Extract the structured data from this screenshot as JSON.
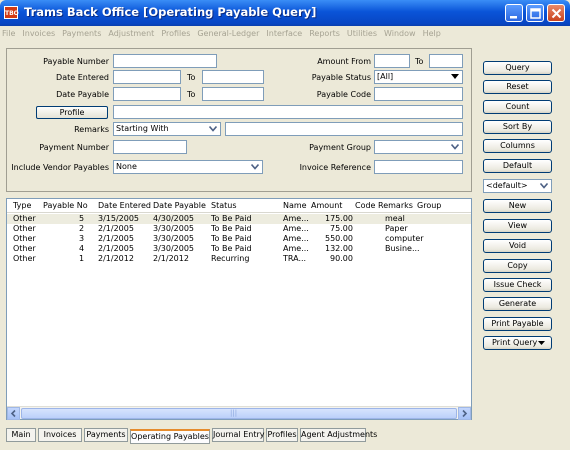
{
  "window": {
    "app_icon_text": "TBO",
    "title": "Trams Back Office [Operating Payable Query]"
  },
  "menu": [
    "File",
    "Invoices",
    "Payments",
    "Adjustment",
    "Profiles",
    "General-Ledger",
    "Interface",
    "Reports",
    "Utilities",
    "Window",
    "Help"
  ],
  "criteria": {
    "payable_number_label": "Payable Number",
    "date_entered_label": "Date Entered",
    "date_payable_label": "Date Payable",
    "to_label_1": "To",
    "to_label_2": "To",
    "to_label_3": "To",
    "profile_button": "Profile",
    "remarks_label": "Remarks",
    "remarks_mode": "Starting With",
    "payment_number_label": "Payment Number",
    "include_vendor_label": "Include Vendor Payables",
    "include_vendor_value": "None",
    "amount_from_label": "Amount From",
    "payable_status_label": "Payable Status",
    "payable_status_value": "[All]",
    "payable_code_label": "Payable Code",
    "payment_group_label": "Payment Group",
    "invoice_reference_label": "Invoice Reference"
  },
  "list": {
    "columns": [
      "Type",
      "Payable No",
      "Date Entered",
      "Date Payable",
      "Status",
      "Name",
      "Amount",
      "Code",
      "Remarks",
      "Group"
    ],
    "rows": [
      {
        "type": "Other",
        "payable_no": "5",
        "date_entered": "3/15/2005",
        "date_payable": "4/30/2005",
        "status": "To Be Paid",
        "name": "Ame...",
        "amount": "175.00",
        "code": "",
        "remarks": "meal",
        "group": ""
      },
      {
        "type": "Other",
        "payable_no": "2",
        "date_entered": "2/1/2005",
        "date_payable": "3/30/2005",
        "status": "To Be Paid",
        "name": "Ame...",
        "amount": "75.00",
        "code": "",
        "remarks": "Paper",
        "group": ""
      },
      {
        "type": "Other",
        "payable_no": "3",
        "date_entered": "2/1/2005",
        "date_payable": "3/30/2005",
        "status": "To Be Paid",
        "name": "Ame...",
        "amount": "550.00",
        "code": "",
        "remarks": "computer",
        "group": ""
      },
      {
        "type": "Other",
        "payable_no": "4",
        "date_entered": "2/1/2005",
        "date_payable": "3/30/2005",
        "status": "To Be Paid",
        "name": "Ame...",
        "amount": "132.00",
        "code": "",
        "remarks": "Busine...",
        "group": ""
      },
      {
        "type": "Other",
        "payable_no": "1",
        "date_entered": "2/1/2012",
        "date_payable": "2/1/2012",
        "status": "Recurring",
        "name": "TRA...",
        "amount": "90.00",
        "code": "",
        "remarks": "",
        "group": ""
      }
    ],
    "scroll_grip": "|||"
  },
  "side_buttons": {
    "query": "Query",
    "reset": "Reset",
    "count": "Count",
    "sort_by": "Sort By",
    "columns": "Columns",
    "default": "Default",
    "layout_value": "<default>",
    "new": "New",
    "view": "View",
    "void": "Void",
    "copy": "Copy",
    "issue_check": "Issue Check",
    "generate": "Generate",
    "print_payable": "Print Payable",
    "print_query": "Print Query"
  },
  "tabs": [
    "Main",
    "Invoices",
    "Payments",
    "Operating Payables",
    "Journal Entry",
    "Profiles",
    "Agent Adjustments"
  ]
}
